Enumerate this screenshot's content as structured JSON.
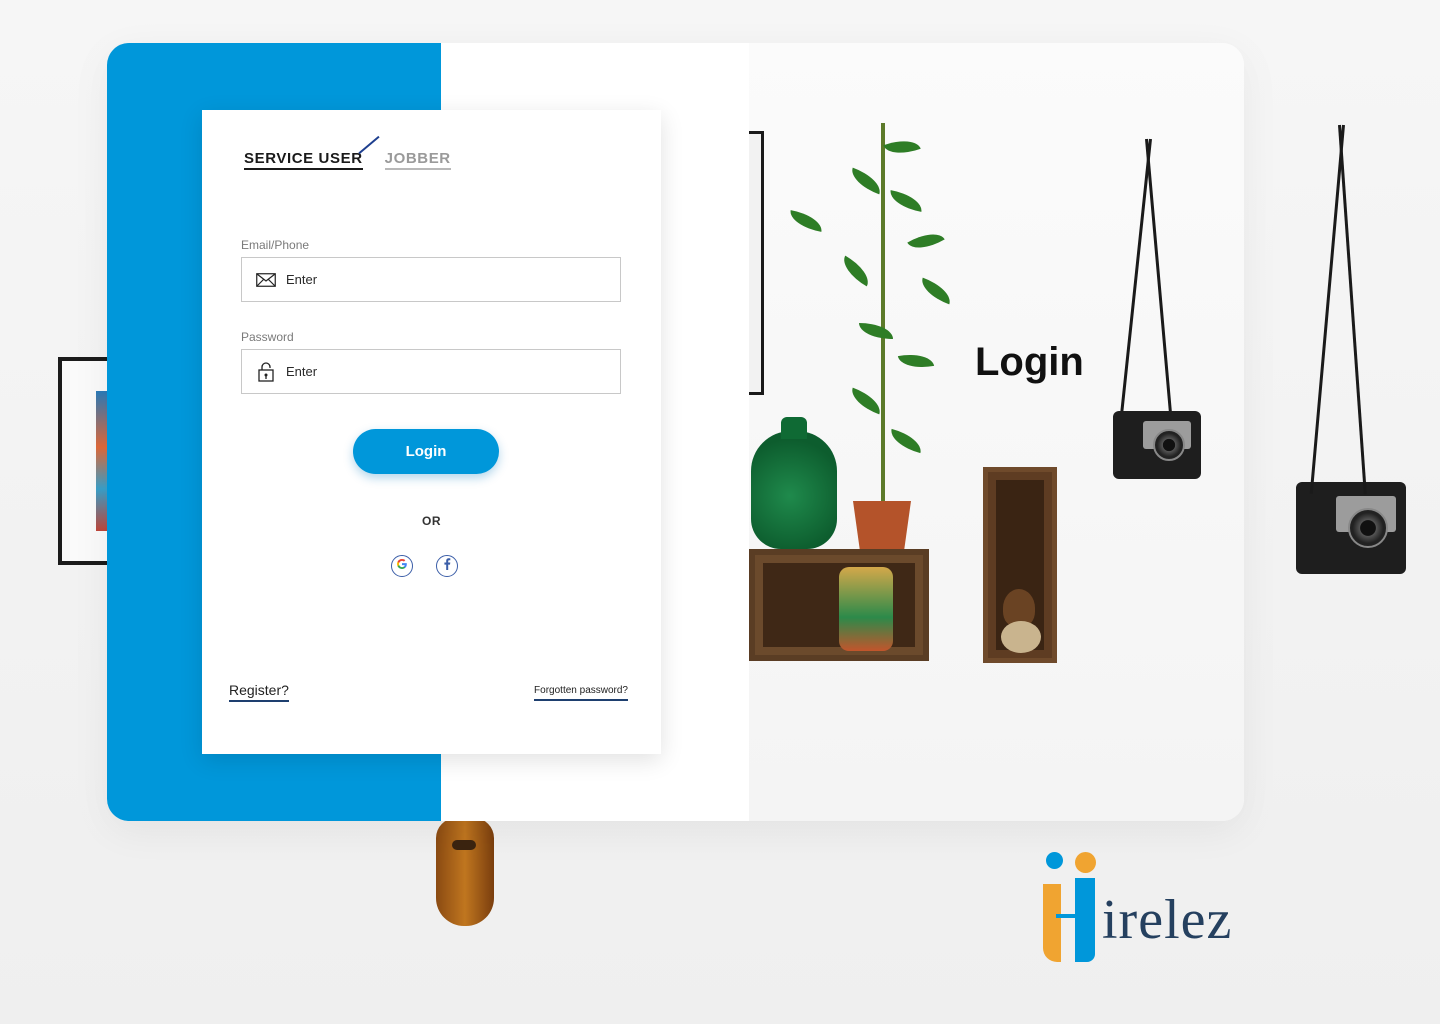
{
  "tabs": {
    "service_user": "SERVICE USER",
    "jobber": "JOBBER"
  },
  "form": {
    "email_label": "Email/Phone",
    "email_placeholder": "Enter",
    "password_label": "Password",
    "password_placeholder": "Enter",
    "login_button": "Login",
    "or_text": "OR"
  },
  "links": {
    "register": "Register?",
    "forgot_password": "Forgotten password?"
  },
  "hero": {
    "title": "Login"
  },
  "brand": {
    "logo_text": "irelez",
    "logo_full_text": "Hirelez"
  },
  "icons": {
    "email": "envelope-icon",
    "password": "lock-icon",
    "google": "google-icon",
    "facebook": "facebook-icon"
  },
  "colors": {
    "primary_blue": "#0097da",
    "brand_orange": "#f0a431",
    "brand_navy": "#25405f"
  }
}
